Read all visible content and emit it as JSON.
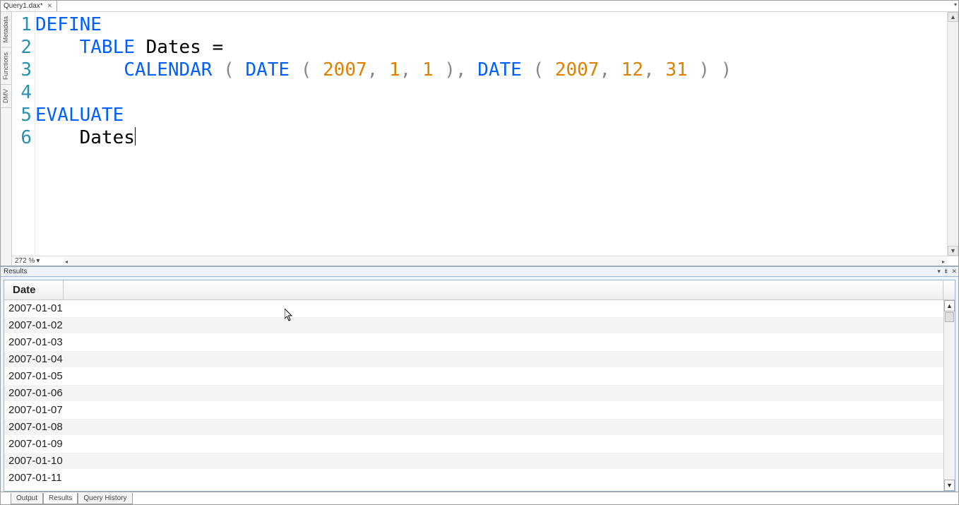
{
  "document": {
    "tab_title": "Query1.dax*",
    "close_glyph": "✕",
    "dropdown_glyph": "▾"
  },
  "side_tabs": [
    "Metadata",
    "Functions",
    "DMV"
  ],
  "editor": {
    "lines": [
      "1",
      "2",
      "3",
      "4",
      "5",
      "6"
    ],
    "zoom": "272 %",
    "code": {
      "l1": {
        "kw": "DEFINE"
      },
      "l2": {
        "indent": "    ",
        "kw": "TABLE",
        "sp": " ",
        "ident": "Dates ="
      },
      "l3": {
        "indent": "        ",
        "fn1": "CALENDAR",
        "sp1": " ",
        "p1": "(",
        "sp2": " ",
        "fn2": "DATE",
        "sp3": " ",
        "p2": "(",
        "sp4": " ",
        "n1": "2007",
        "c1": ",",
        "sp5": " ",
        "n2": "1",
        "c2": ",",
        "sp6": " ",
        "n3": "1",
        "sp7": " ",
        "p3": ")",
        "c3": ",",
        "sp8": " ",
        "fn3": "DATE",
        "sp9": " ",
        "p4": "(",
        "sp10": " ",
        "n4": "2007",
        "c4": ",",
        "sp11": " ",
        "n5": "12",
        "c5": ",",
        "sp12": " ",
        "n6": "31",
        "sp13": " ",
        "p5": ")",
        "sp14": " ",
        "p6": ")"
      },
      "l5": {
        "kw": "EVALUATE"
      },
      "l6": {
        "indent": "    ",
        "ident": "Dates"
      }
    }
  },
  "results": {
    "panel_title": "Results",
    "controls": {
      "pin_glyph": "▾",
      "autohide_glyph": "⇟",
      "close_glyph": "✕"
    },
    "column": "Date",
    "rows": [
      "2007-01-01",
      "2007-01-02",
      "2007-01-03",
      "2007-01-04",
      "2007-01-05",
      "2007-01-06",
      "2007-01-07",
      "2007-01-08",
      "2007-01-09",
      "2007-01-10",
      "2007-01-11"
    ],
    "scroll": {
      "up_glyph": "▲",
      "down_glyph": "▼"
    }
  },
  "bottom_tabs": {
    "output": "Output",
    "results": "Results",
    "history": "Query History"
  }
}
